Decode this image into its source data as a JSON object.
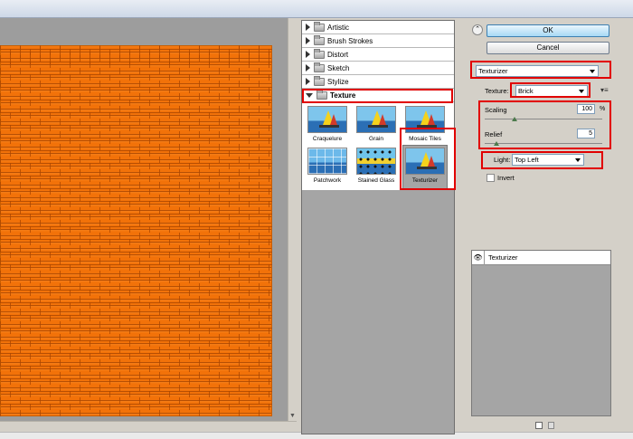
{
  "preview": {
    "texture_color": "#f27209"
  },
  "gallery": {
    "categories": [
      {
        "label": "Artistic",
        "expanded": false
      },
      {
        "label": "Brush Strokes",
        "expanded": false
      },
      {
        "label": "Distort",
        "expanded": false
      },
      {
        "label": "Sketch",
        "expanded": false
      },
      {
        "label": "Stylize",
        "expanded": false
      },
      {
        "label": "Texture",
        "expanded": true
      }
    ],
    "texture_filters": [
      "Craquelure",
      "Grain",
      "Mosaic Tiles",
      "Patchwork",
      "Stained Glass",
      "Texturizer"
    ],
    "selected_filter": "Texturizer"
  },
  "buttons": {
    "ok": "OK",
    "cancel": "Cancel"
  },
  "filter_select": {
    "value": "Texturizer"
  },
  "texture": {
    "label": "Texture:",
    "value": "Brick"
  },
  "scaling": {
    "label": "Scaling",
    "value": "100",
    "unit": "%",
    "level": 0.25
  },
  "relief": {
    "label": "Relief",
    "value": "5",
    "level": 0.1
  },
  "light": {
    "label": "Light:",
    "value": "Top Left"
  },
  "invert": {
    "label": "Invert",
    "checked": false
  },
  "layers": {
    "items": [
      {
        "name": "Texturizer",
        "visible": true
      }
    ]
  },
  "highlight_color": "#e10000",
  "icons": [
    "eye-icon",
    "folder-icon",
    "expand-triangle-icon",
    "collapse-icon",
    "new-layer-icon",
    "delete-layer-icon",
    "panel-menu-icon"
  ]
}
